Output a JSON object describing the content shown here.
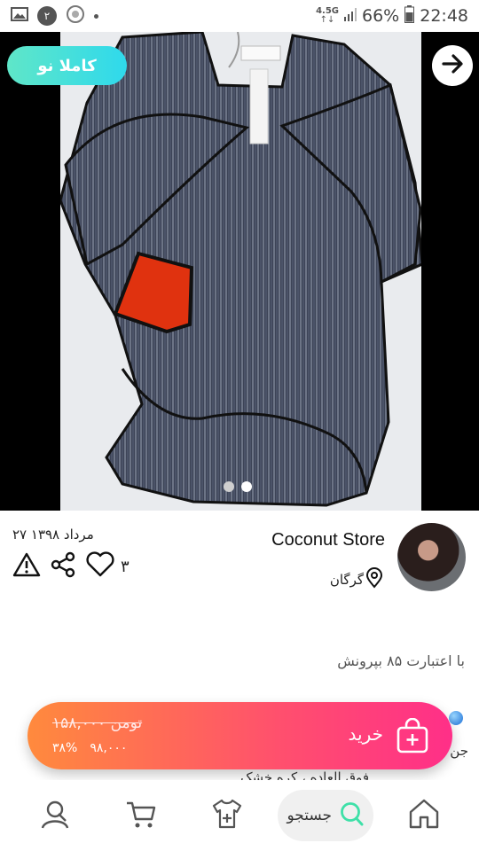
{
  "status": {
    "badge": "۲",
    "network_top": "4.5G",
    "network_bottom": "↑↓",
    "battery": "66%",
    "time": "22:48"
  },
  "hero": {
    "condition_label": "کاملا نو",
    "current_slide": 2,
    "total_slides": 2
  },
  "product": {
    "date": "۲۷ مرداد ۱۳۹۸",
    "likes": "۳",
    "credit": "با اعتبارت ۸۵ بپرونش"
  },
  "store": {
    "name": "Coconut Store",
    "city": "گرگان"
  },
  "buy": {
    "old_price": "۱۵۸,۰۰۰ تومن",
    "new_price": "۹۸,۰۰۰",
    "discount": "۳۸%",
    "label": "خرید"
  },
  "behind_text": {
    "line1": "جن",
    "line2": "فوق العاده ، کره خشک"
  },
  "nav": {
    "search_label": "جستجو"
  },
  "colors": {
    "pill_gradient": [
      "#5fe6c8",
      "#2fd9ec"
    ],
    "buy_gradient": [
      "#ff8a3d",
      "#ff2f88"
    ],
    "garment": "#3d4457",
    "pocket": "#e0320f"
  }
}
